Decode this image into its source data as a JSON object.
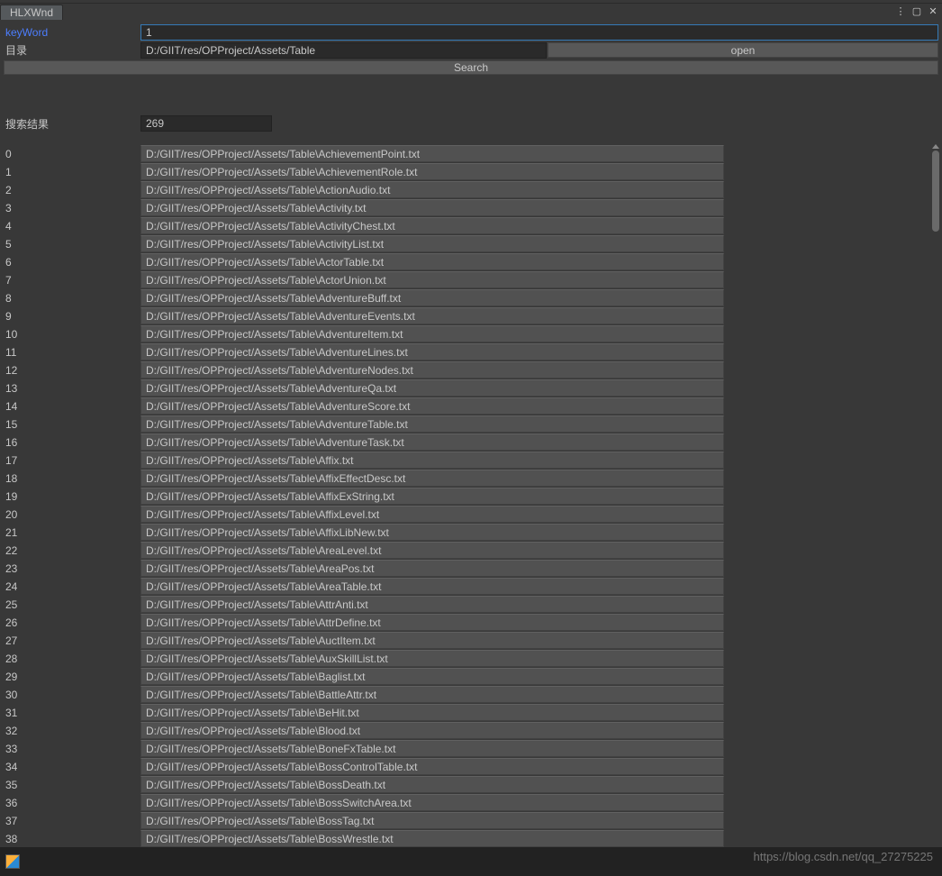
{
  "window": {
    "tab_title": "HLXWnd"
  },
  "form": {
    "keyword_label": "keyWord",
    "keyword_value": "1",
    "dir_label": "目录",
    "dir_value": "D:/GIIT/res/OPProject/Assets/Table",
    "open_label": "open",
    "search_label": "Search"
  },
  "results": {
    "label": "搜索结果",
    "count": "269",
    "items": [
      {
        "idx": "0",
        "path": "D:/GIIT/res/OPProject/Assets/Table\\AchievementPoint.txt"
      },
      {
        "idx": "1",
        "path": "D:/GIIT/res/OPProject/Assets/Table\\AchievementRole.txt"
      },
      {
        "idx": "2",
        "path": "D:/GIIT/res/OPProject/Assets/Table\\ActionAudio.txt"
      },
      {
        "idx": "3",
        "path": "D:/GIIT/res/OPProject/Assets/Table\\Activity.txt"
      },
      {
        "idx": "4",
        "path": "D:/GIIT/res/OPProject/Assets/Table\\ActivityChest.txt"
      },
      {
        "idx": "5",
        "path": "D:/GIIT/res/OPProject/Assets/Table\\ActivityList.txt"
      },
      {
        "idx": "6",
        "path": "D:/GIIT/res/OPProject/Assets/Table\\ActorTable.txt"
      },
      {
        "idx": "7",
        "path": "D:/GIIT/res/OPProject/Assets/Table\\ActorUnion.txt"
      },
      {
        "idx": "8",
        "path": "D:/GIIT/res/OPProject/Assets/Table\\AdventureBuff.txt"
      },
      {
        "idx": "9",
        "path": "D:/GIIT/res/OPProject/Assets/Table\\AdventureEvents.txt"
      },
      {
        "idx": "10",
        "path": "D:/GIIT/res/OPProject/Assets/Table\\AdventureItem.txt"
      },
      {
        "idx": "11",
        "path": "D:/GIIT/res/OPProject/Assets/Table\\AdventureLines.txt"
      },
      {
        "idx": "12",
        "path": "D:/GIIT/res/OPProject/Assets/Table\\AdventureNodes.txt"
      },
      {
        "idx": "13",
        "path": "D:/GIIT/res/OPProject/Assets/Table\\AdventureQa.txt"
      },
      {
        "idx": "14",
        "path": "D:/GIIT/res/OPProject/Assets/Table\\AdventureScore.txt"
      },
      {
        "idx": "15",
        "path": "D:/GIIT/res/OPProject/Assets/Table\\AdventureTable.txt"
      },
      {
        "idx": "16",
        "path": "D:/GIIT/res/OPProject/Assets/Table\\AdventureTask.txt"
      },
      {
        "idx": "17",
        "path": "D:/GIIT/res/OPProject/Assets/Table\\Affix.txt"
      },
      {
        "idx": "18",
        "path": "D:/GIIT/res/OPProject/Assets/Table\\AffixEffectDesc.txt"
      },
      {
        "idx": "19",
        "path": "D:/GIIT/res/OPProject/Assets/Table\\AffixExString.txt"
      },
      {
        "idx": "20",
        "path": "D:/GIIT/res/OPProject/Assets/Table\\AffixLevel.txt"
      },
      {
        "idx": "21",
        "path": "D:/GIIT/res/OPProject/Assets/Table\\AffixLibNew.txt"
      },
      {
        "idx": "22",
        "path": "D:/GIIT/res/OPProject/Assets/Table\\AreaLevel.txt"
      },
      {
        "idx": "23",
        "path": "D:/GIIT/res/OPProject/Assets/Table\\AreaPos.txt"
      },
      {
        "idx": "24",
        "path": "D:/GIIT/res/OPProject/Assets/Table\\AreaTable.txt"
      },
      {
        "idx": "25",
        "path": "D:/GIIT/res/OPProject/Assets/Table\\AttrAnti.txt"
      },
      {
        "idx": "26",
        "path": "D:/GIIT/res/OPProject/Assets/Table\\AttrDefine.txt"
      },
      {
        "idx": "27",
        "path": "D:/GIIT/res/OPProject/Assets/Table\\AuctItem.txt"
      },
      {
        "idx": "28",
        "path": "D:/GIIT/res/OPProject/Assets/Table\\AuxSkillList.txt"
      },
      {
        "idx": "29",
        "path": "D:/GIIT/res/OPProject/Assets/Table\\Baglist.txt"
      },
      {
        "idx": "30",
        "path": "D:/GIIT/res/OPProject/Assets/Table\\BattleAttr.txt"
      },
      {
        "idx": "31",
        "path": "D:/GIIT/res/OPProject/Assets/Table\\BeHit.txt"
      },
      {
        "idx": "32",
        "path": "D:/GIIT/res/OPProject/Assets/Table\\Blood.txt"
      },
      {
        "idx": "33",
        "path": "D:/GIIT/res/OPProject/Assets/Table\\BoneFxTable.txt"
      },
      {
        "idx": "34",
        "path": "D:/GIIT/res/OPProject/Assets/Table\\BossControlTable.txt"
      },
      {
        "idx": "35",
        "path": "D:/GIIT/res/OPProject/Assets/Table\\BossDeath.txt"
      },
      {
        "idx": "36",
        "path": "D:/GIIT/res/OPProject/Assets/Table\\BossSwitchArea.txt"
      },
      {
        "idx": "37",
        "path": "D:/GIIT/res/OPProject/Assets/Table\\BossTag.txt"
      },
      {
        "idx": "38",
        "path": "D:/GIIT/res/OPProject/Assets/Table\\BossWrestle.txt"
      }
    ]
  },
  "watermark": "https://blog.csdn.net/qq_27275225"
}
